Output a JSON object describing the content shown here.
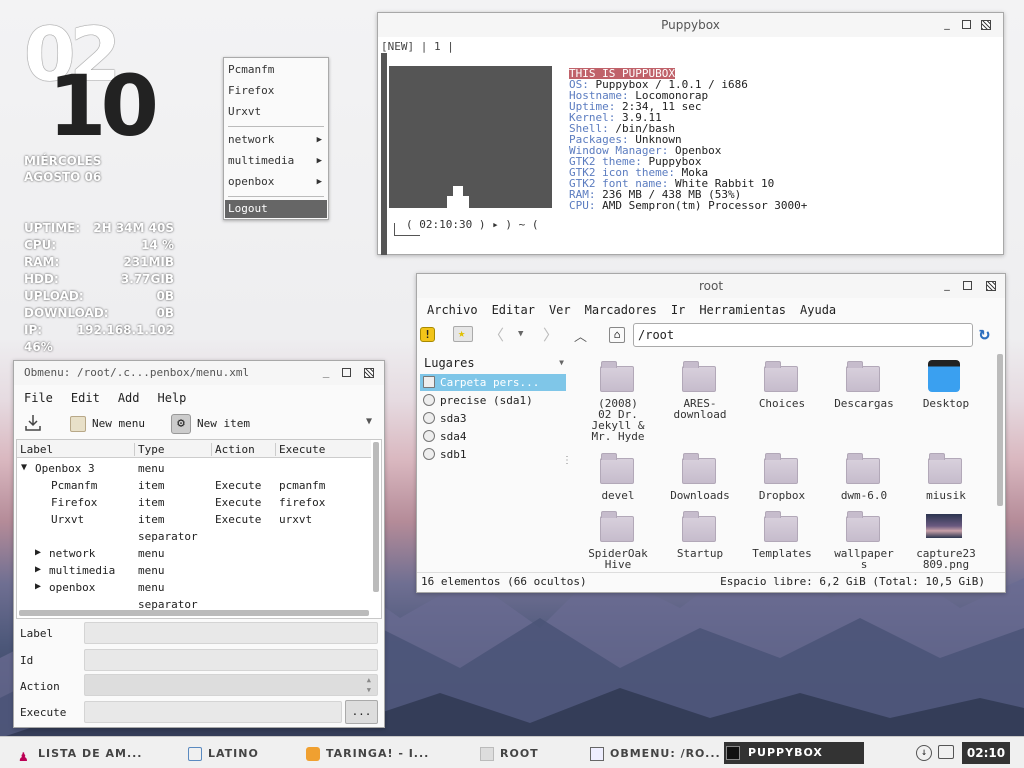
{
  "conky": {
    "hour": "02",
    "minute": "10",
    "weekday": "MIÉRCOLES",
    "date": "AGOSTO 06",
    "stats": [
      {
        "label": "UPTIME:",
        "value": "2H 34M 40S"
      },
      {
        "label": "CPU:",
        "value": "14 %"
      },
      {
        "label": "RAM:",
        "value": "231MIB"
      },
      {
        "label": "HDD:",
        "value": "3.77GIB"
      },
      {
        "label": "UPLOAD:",
        "value": "0B"
      },
      {
        "label": "DOWNLOAD:",
        "value": "0B"
      },
      {
        "label": "IP:",
        "value": "192.168.1.102"
      },
      {
        "label": "46%",
        "value": ""
      }
    ]
  },
  "root_menu": {
    "items": [
      "Pcmanfm",
      "Firefox",
      "Urxvt"
    ],
    "submenus": [
      "network",
      "multimedia",
      "openbox"
    ],
    "logout": "Logout"
  },
  "terminal": {
    "title": "Puppybox",
    "tabbar": "[NEW] | 1 |",
    "banner": "THIS IS PUPPUBOX",
    "info": [
      {
        "label": "OS:",
        "value": "Puppybox / 1.0.1 / i686"
      },
      {
        "label": "Hostname:",
        "value": "Locomonorap"
      },
      {
        "label": "Uptime:",
        "value": "2:34, 11 sec"
      },
      {
        "label": "Kernel:",
        "value": "3.9.11"
      },
      {
        "label": "Shell:",
        "value": "/bin/bash"
      },
      {
        "label": "Packages:",
        "value": "Unknown"
      },
      {
        "label": "Window Manager:",
        "value": "Openbox"
      },
      {
        "label": "GTK2 theme:",
        "value": "Puppybox"
      },
      {
        "label": "GTK2 icon theme:",
        "value": "Moka"
      },
      {
        "label": "GTK2 font name:",
        "value": "White Rabbit 10"
      },
      {
        "label": "RAM:",
        "value": "236 MB / 438 MB (53%)"
      },
      {
        "label": "CPU:",
        "value": "AMD Sempron(tm) Processor 3000+"
      }
    ],
    "prompt": "( 02:10:30 ) ▸ ) ~ ("
  },
  "menu_editor": {
    "title": "Obmenu: /root/.c...penbox/menu.xml",
    "menubar": [
      "File",
      "Edit",
      "Add",
      "Help"
    ],
    "toolbar": {
      "new_menu": "New menu",
      "new_item": "New item"
    },
    "columns": [
      "Label",
      "Type",
      "Action",
      "Execute"
    ],
    "rows": [
      {
        "label": "Openbox 3",
        "type": "menu",
        "action": "",
        "execute": "",
        "expander": "▼"
      },
      {
        "label": "Pcmanfm",
        "type": "item",
        "action": "Execute",
        "execute": "pcmanfm",
        "expander": ""
      },
      {
        "label": "Firefox",
        "type": "item",
        "action": "Execute",
        "execute": "firefox",
        "expander": ""
      },
      {
        "label": "Urxvt",
        "type": "item",
        "action": "Execute",
        "execute": "urxvt",
        "expander": ""
      },
      {
        "label": "",
        "type": "separator",
        "action": "",
        "execute": "",
        "expander": ""
      },
      {
        "label": "network",
        "type": "menu",
        "action": "",
        "execute": "",
        "expander": "▶"
      },
      {
        "label": "multimedia",
        "type": "menu",
        "action": "",
        "execute": "",
        "expander": "▶"
      },
      {
        "label": "openbox",
        "type": "menu",
        "action": "",
        "execute": "",
        "expander": "▶"
      },
      {
        "label": "",
        "type": "separator",
        "action": "",
        "execute": "",
        "expander": ""
      }
    ],
    "fields": [
      "Label",
      "Id",
      "Action",
      "Execute"
    ],
    "browse": "..."
  },
  "file_manager": {
    "title": "root",
    "menubar": [
      "Archivo",
      "Editar",
      "Ver",
      "Marcadores",
      "Ir",
      "Herramientas",
      "Ayuda"
    ],
    "path": "/root",
    "places_header": "Lugares",
    "places": [
      "Carpeta pers...",
      "precise (sda1)",
      "sda3",
      "sda4",
      "sdb1"
    ],
    "files": [
      [
        "(2008)",
        "02 Dr.",
        "Jekyll &",
        "Mr. Hyde"
      ],
      [
        "ARES-",
        "download"
      ],
      [
        "Choices"
      ],
      [
        "Descargas"
      ],
      [
        "Desktop"
      ],
      [
        "devel"
      ],
      [
        "Downloads"
      ],
      [
        "Dropbox"
      ],
      [
        "dwm-6.0"
      ],
      [
        "miusik"
      ],
      [
        "SpiderOak",
        "Hive"
      ],
      [
        "Startup"
      ],
      [
        "Templates"
      ],
      [
        "wallpaper",
        "s"
      ],
      [
        "capture23",
        "809.png"
      ]
    ],
    "status_left": "16 elementos (66 ocultos)",
    "status_right": "Espacio libre: 6,2 GiB (Total: 10,5 GiB)"
  },
  "taskbar": {
    "items": [
      "LISTA DE AM...",
      "LATINO",
      "TARINGA! - I...",
      "ROOT",
      "OBMENU: /RO...",
      "PUPPYBOX"
    ],
    "clock": "02:10"
  }
}
